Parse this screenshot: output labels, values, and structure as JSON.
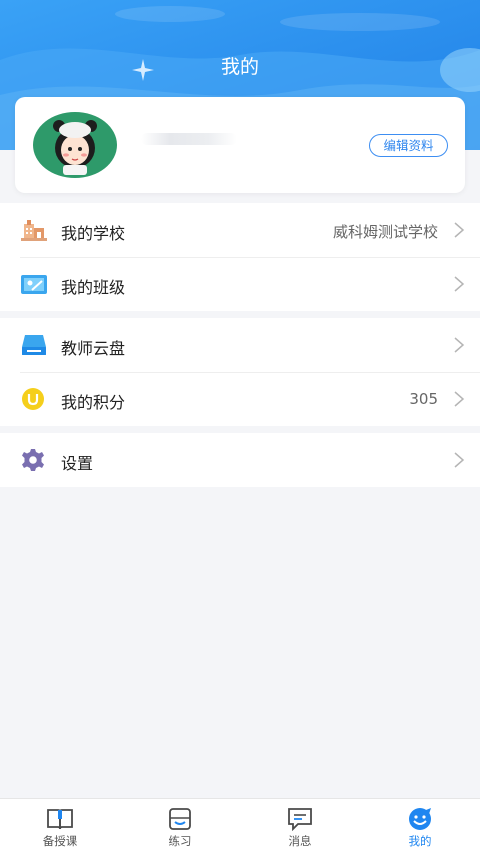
{
  "header": {
    "title": "我的"
  },
  "profile": {
    "edit_label": "编辑资料"
  },
  "groups": [
    {
      "items": [
        {
          "label": "我的学校",
          "value": "威科姆测试学校",
          "icon": "school-building-icon"
        },
        {
          "label": "我的班级",
          "value": "",
          "icon": "classroom-board-icon"
        }
      ]
    },
    {
      "items": [
        {
          "label": "教师云盘",
          "value": "",
          "icon": "cloud-disk-icon"
        },
        {
          "label": "我的积分",
          "value": "305",
          "icon": "points-coin-icon"
        }
      ]
    },
    {
      "items": [
        {
          "label": "设置",
          "value": "",
          "icon": "gear-icon"
        }
      ]
    }
  ],
  "tabbar": {
    "tabs": [
      {
        "label": "备授课",
        "icon": "book-icon"
      },
      {
        "label": "练习",
        "icon": "practice-icon"
      },
      {
        "label": "消息",
        "icon": "message-icon"
      },
      {
        "label": "我的",
        "icon": "mine-face-icon"
      }
    ],
    "active_index": 3
  },
  "colors": {
    "primary": "#2c90f0",
    "accent_blue": "#1f86f0",
    "background": "#f4f5f8"
  }
}
